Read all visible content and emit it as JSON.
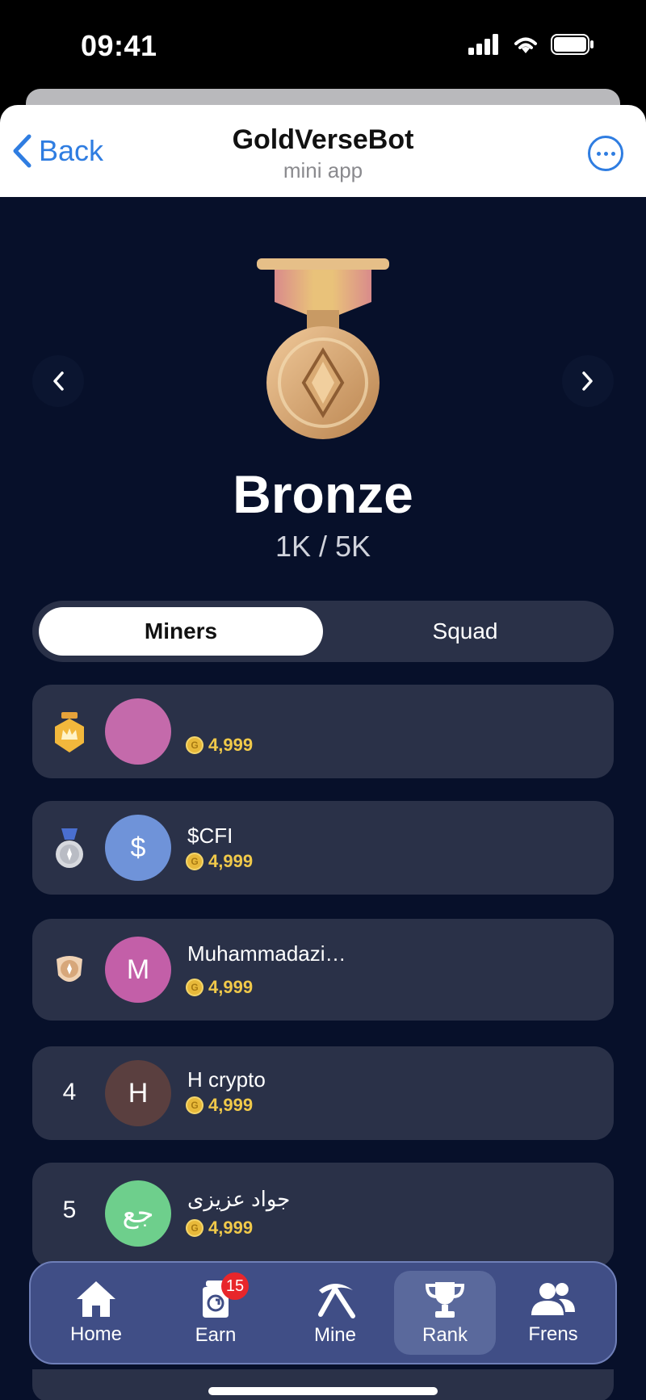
{
  "status_bar": {
    "time": "09:41"
  },
  "header": {
    "back_label": "Back",
    "title": "GoldVerseBot",
    "subtitle": "mini app"
  },
  "tier": {
    "name": "Bronze",
    "progress": "1K / 5K"
  },
  "tabs": [
    {
      "label": "Miners",
      "active": true
    },
    {
      "label": "Squad",
      "active": false
    }
  ],
  "leaderboard": [
    {
      "rank": "1",
      "badge": "gold-crown",
      "avatar_letter": "",
      "avatar_color": "#c46aab",
      "name": "",
      "score": "4,999"
    },
    {
      "rank": "2",
      "badge": "silver-medal",
      "avatar_letter": "$",
      "avatar_color": "#6f93d9",
      "name": "$CFI",
      "score": "4,999"
    },
    {
      "rank": "3",
      "badge": "bronze-shield",
      "avatar_letter": "M",
      "avatar_color": "#c35fa8",
      "name": "Muhammadazi…",
      "score": "4,999"
    },
    {
      "rank": "4",
      "badge": "",
      "avatar_letter": "H",
      "avatar_color": "#5a3f3f",
      "name": "H crypto",
      "score": "4,999"
    },
    {
      "rank": "5",
      "badge": "",
      "avatar_letter": "جع",
      "avatar_color": "#6ecf8c",
      "name": "جواد عزیزی",
      "score": "4,999"
    }
  ],
  "bottom_nav": [
    {
      "label": "Home",
      "icon": "home-icon",
      "badge": ""
    },
    {
      "label": "Earn",
      "icon": "earn-jar-icon",
      "badge": "15"
    },
    {
      "label": "Mine",
      "icon": "pickaxe-icon",
      "badge": ""
    },
    {
      "label": "Rank",
      "icon": "trophy-icon",
      "badge": "",
      "active": true
    },
    {
      "label": "Frens",
      "icon": "friends-icon",
      "badge": ""
    }
  ],
  "colors": {
    "background": "#07102a",
    "card": "#2a3148",
    "nav": "#404e86",
    "accent_gold": "#f0c94a",
    "link_blue": "#2f7de1"
  }
}
